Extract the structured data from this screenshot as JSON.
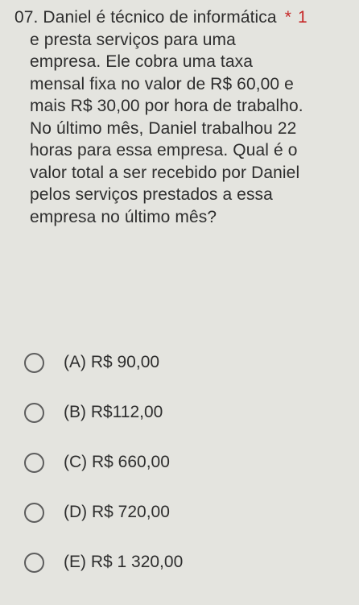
{
  "question": {
    "lines": [
      "07. Daniel é técnico de informática",
      "e presta serviços para uma",
      "empresa. Ele cobra uma taxa",
      "mensal fixa no valor de R$ 60,00 e",
      "mais R$ 30,00 por hora de trabalho.",
      "No último mês, Daniel trabalhou 22",
      "horas para essa empresa. Qual é o",
      "valor total a ser recebido por Daniel",
      "pelos serviços prestados a essa",
      "empresa no último mês?"
    ],
    "required_marker": "*",
    "cut_text": "1"
  },
  "options": [
    {
      "label": "(A) R$ 90,00"
    },
    {
      "label": "(B) R$112,00"
    },
    {
      "label": "(C) R$ 660,00"
    },
    {
      "label": "(D) R$ 720,00"
    },
    {
      "label": "(E) R$ 1 320,00"
    }
  ],
  "colors": {
    "background": "#e4e4df",
    "text": "#2e2e2e",
    "required": "#c62828",
    "radio_border": "#5d5d5d"
  }
}
